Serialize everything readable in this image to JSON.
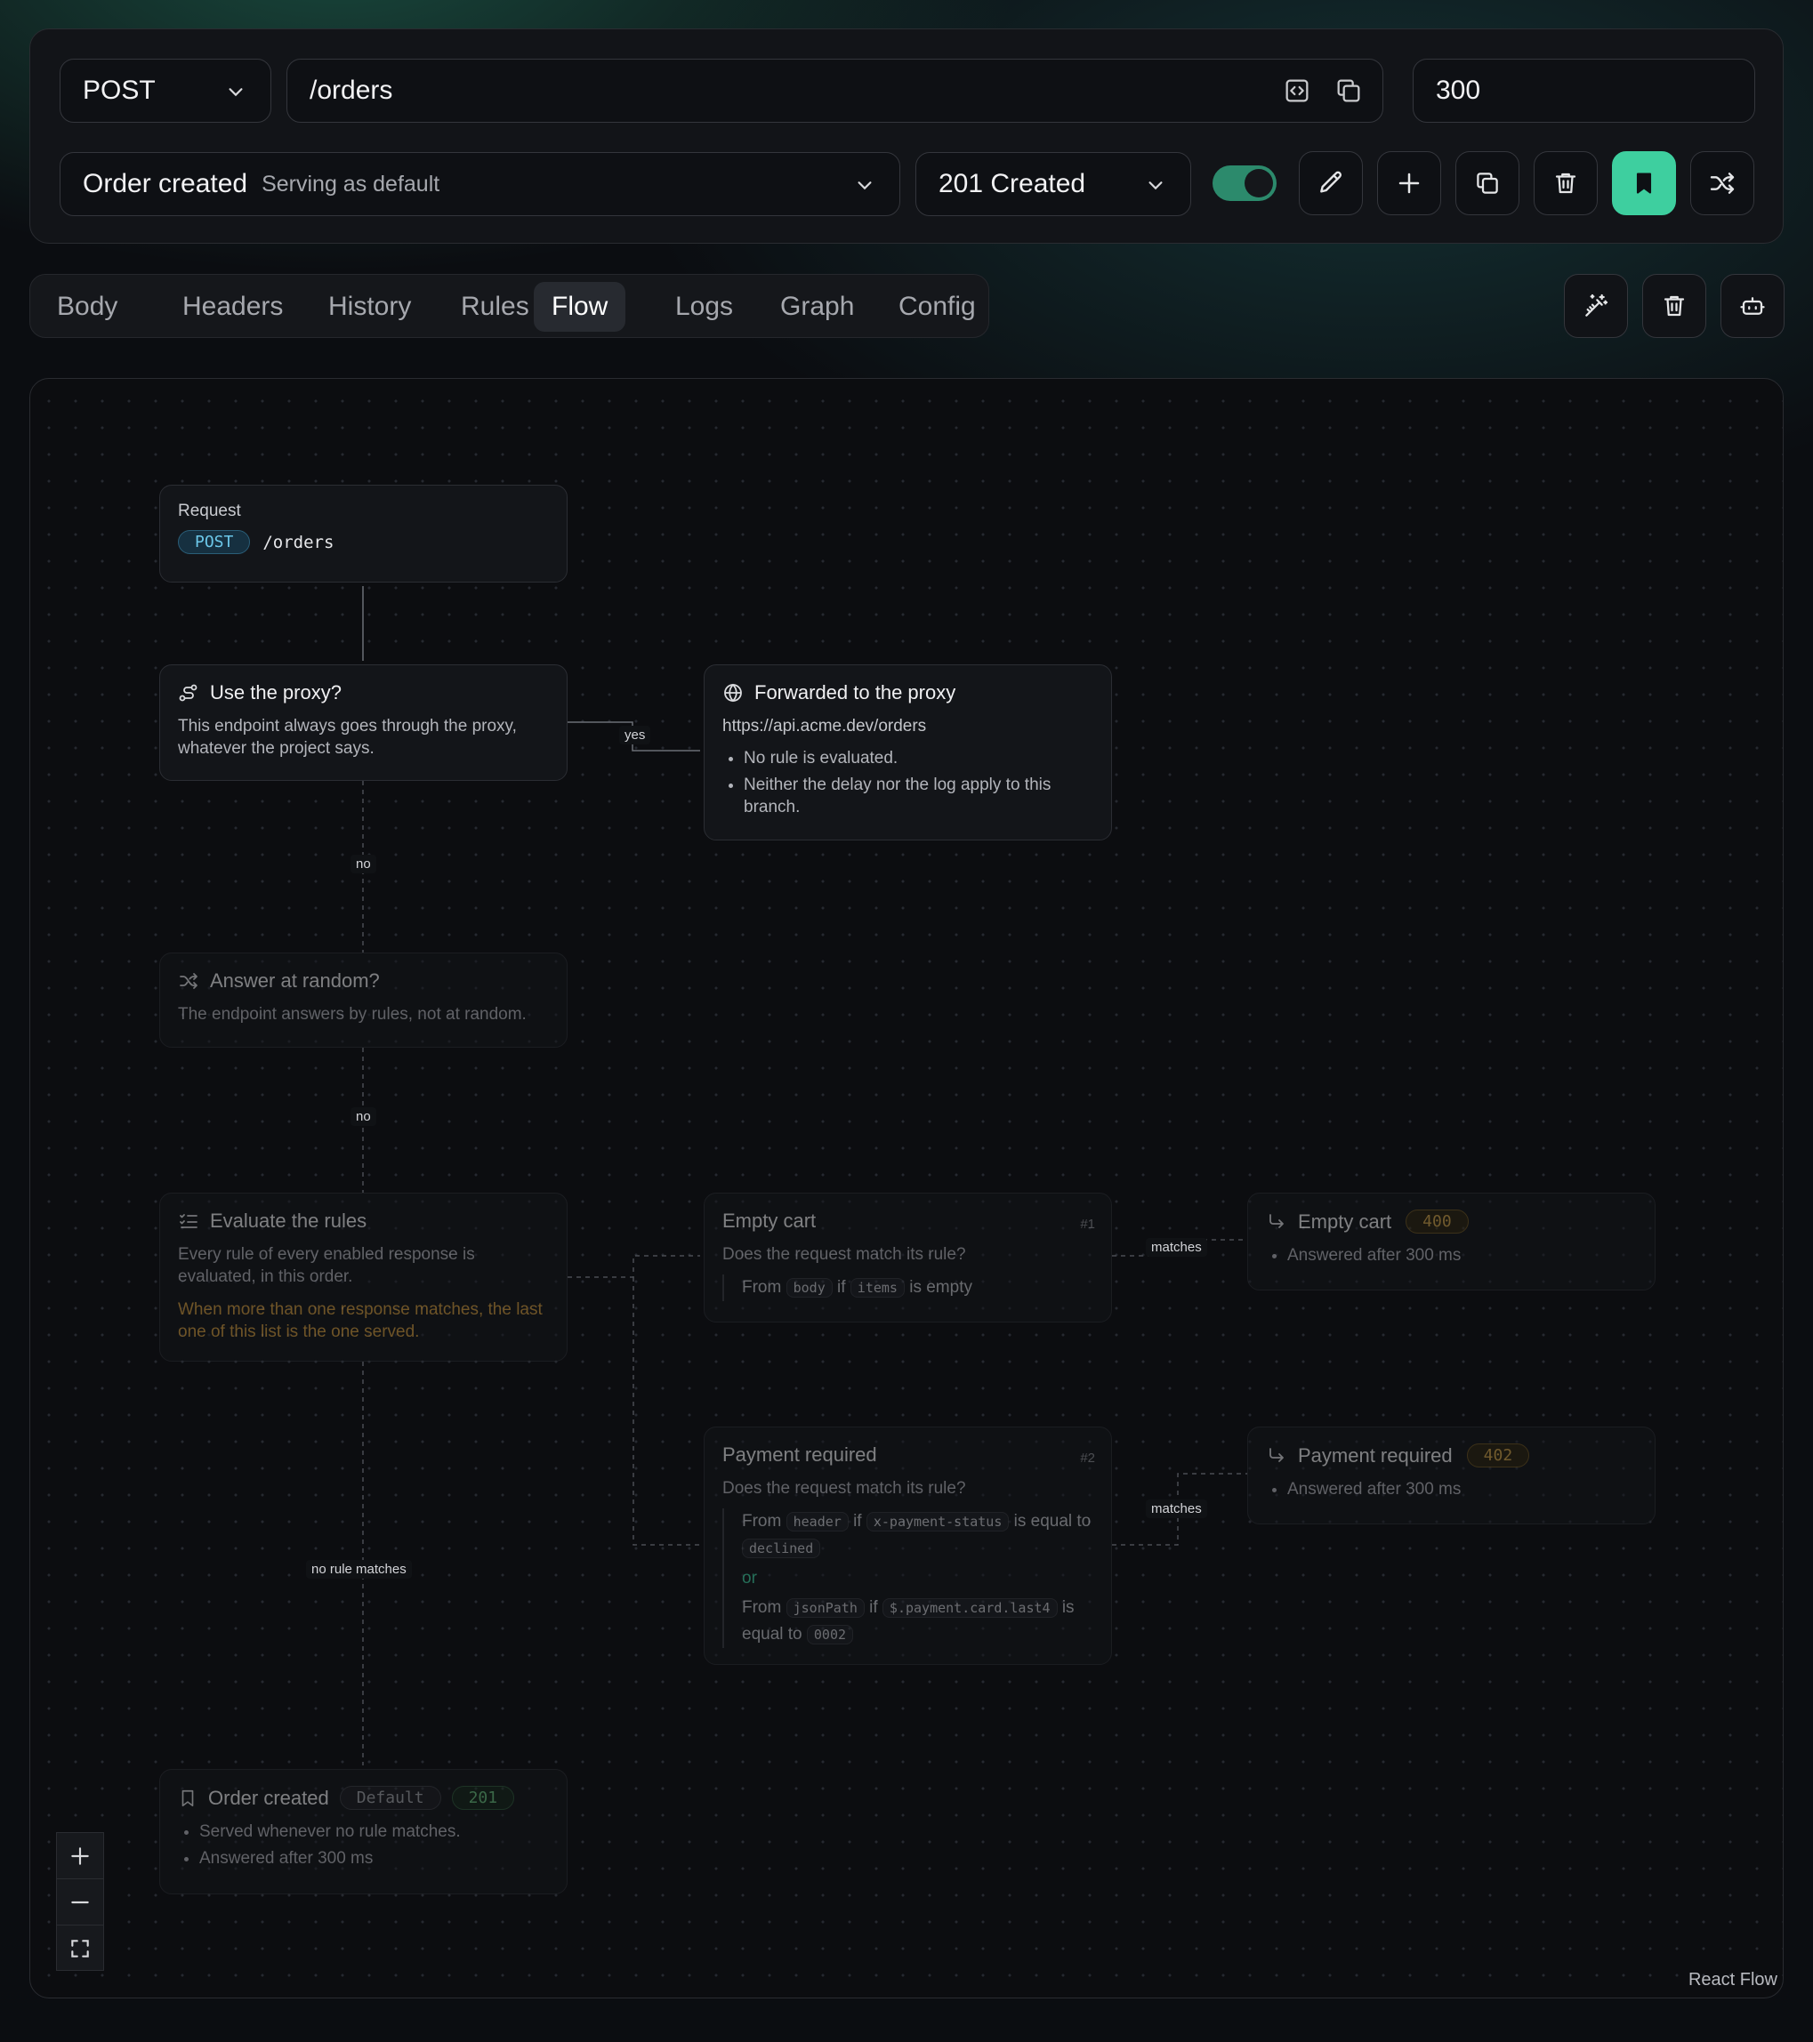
{
  "colors": {
    "accent": "#3ecf9f",
    "background": "#0b0d11",
    "warning": "#d09a3e"
  },
  "request_bar": {
    "method": "POST",
    "path": "/orders",
    "delay": "300"
  },
  "response_bar": {
    "response_name": "Order created",
    "response_hint": "Serving as default",
    "status": "201 Created",
    "enabled": true,
    "icons": [
      "pencil-icon",
      "plus-icon",
      "copy-icon",
      "trash-icon",
      "bookmark-icon",
      "shuffle-icon"
    ]
  },
  "tabs": [
    "Body",
    "Headers",
    "History",
    "Rules",
    "Flow",
    "Logs",
    "Graph",
    "Config"
  ],
  "active_tab": "Flow",
  "tools": [
    "wand-icon",
    "trash-icon",
    "bot-icon"
  ],
  "flow": {
    "request": {
      "label": "Request",
      "method": "POST",
      "path": "/orders"
    },
    "proxy": {
      "title": "Use the proxy?",
      "text": "This endpoint always goes through the proxy, whatever the project says."
    },
    "forwarded": {
      "title": "Forwarded to the proxy",
      "url": "https://api.acme.dev/orders",
      "points": [
        "No rule is evaluated.",
        "Neither the delay nor the log apply to this branch."
      ]
    },
    "random": {
      "title": "Answer at random?",
      "text": "The endpoint answers by rules, not at random."
    },
    "evaluate": {
      "title": "Evaluate the rules",
      "text": "Every rule of every enabled response is evaluated, in this order.",
      "warning": "When more than one response matches, the last one of this list is the one served."
    },
    "rule1": {
      "title": "Empty cart",
      "number": "#1",
      "question": "Does the request match its rule?",
      "from": "From",
      "source": "body",
      "if": "if",
      "field": "items",
      "op": "is empty"
    },
    "rule2": {
      "title": "Payment required",
      "number": "#2",
      "question": "Does the request match its rule?",
      "c1_from": "From",
      "c1_source": "header",
      "c1_if": "if",
      "c1_field": "x-payment-status",
      "c1_op": "is equal to",
      "c1_value": "declined",
      "or": "or",
      "c2_from": "From",
      "c2_source": "jsonPath",
      "c2_if": "if",
      "c2_field": "$.payment.card.last4",
      "c2_op": "is equal to",
      "c2_value": "0002"
    },
    "result1": {
      "title": "Empty cart",
      "code": "400",
      "note": "Answered after 300 ms"
    },
    "result2": {
      "title": "Payment required",
      "code": "402",
      "note": "Answered after 300 ms"
    },
    "default": {
      "title": "Order created",
      "tag": "Default",
      "code": "201",
      "notes": [
        "Served whenever no rule matches.",
        "Answered after 300 ms"
      ]
    },
    "edge_labels": {
      "yes": "yes",
      "no1": "no",
      "no2": "no",
      "matches1": "matches",
      "matches2": "matches",
      "no_rule": "no rule matches"
    }
  },
  "attribution": "React Flow"
}
